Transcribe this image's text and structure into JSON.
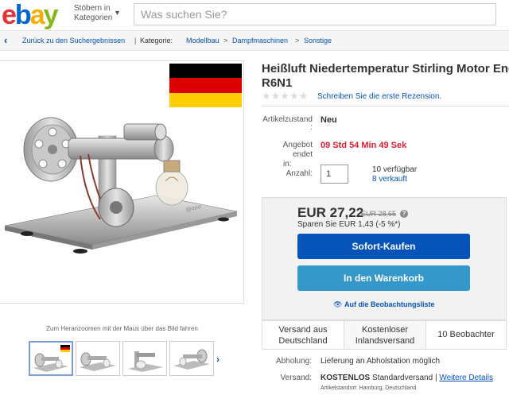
{
  "header": {
    "logo": [
      "e",
      "b",
      "a",
      "y"
    ],
    "browse_line1": "Stöbern in",
    "browse_line2": "Kategorien",
    "search_placeholder": "Was suchen Sie?"
  },
  "breadcrumb": {
    "back": "Zurück zu den Suchergebnissen",
    "category_label": "Kategorie:",
    "items": [
      "Modellbau",
      "Dampfmaschinen",
      "Sonstige"
    ],
    "separator": ">"
  },
  "item": {
    "title_line1": "Heißluft Niedertemperatur Stirling Motor Engine",
    "title_line2": "R6N1",
    "review_link": "Schreiben Sie die erste Rezension.",
    "condition_label": "Artikelzustand",
    "condition_colon": ":",
    "condition": "Neu",
    "offer_label_1": "Angebot endet",
    "offer_label_2": "in:",
    "time_left": "09 Std 54 Min 49 Sek",
    "qty_label": "Anzahl:",
    "qty_value": "1",
    "available": "10 verfügbar",
    "sold": "8 verkauft"
  },
  "buy": {
    "price": "EUR 27,22",
    "old_price": "EUR 28,65",
    "info": "?",
    "savings": "Sparen Sie EUR 1,43 (-5 %*)",
    "buy_now": "Sofort-Kaufen",
    "add_to_cart": "In den Warenkorb",
    "watch_icon": "👁",
    "watch": "Auf die Beobachtungsliste"
  },
  "shipping_box": {
    "cell1_line1": "Versand aus",
    "cell1_line2": "Deutschland",
    "cell2_line1": "Kostenloser",
    "cell2_line2": "Inlandsversand",
    "cell3": "10 Beobachter"
  },
  "delivery": {
    "pickup_label": "Abholung:",
    "pickup": "Lieferung an Abholstation möglich",
    "shipping_label": "Versand:",
    "shipping_free": "KOSTENLOS",
    "shipping_type": "Standardversand |",
    "details_link": "Weitere Details",
    "location": "Artikelstandort:  Hamburg, Deutschland"
  },
  "gallery": {
    "zoom_hint": "Zum Heranzoomen mit der Maus über das Bild fahren",
    "next": "›"
  },
  "colors": {
    "link": "#0654ba",
    "buy_button": "#0654ba",
    "cart_button": "#3498ca",
    "timer": "#dd1e31",
    "flag": [
      "#000000",
      "#dd0000",
      "#ffce00"
    ]
  }
}
